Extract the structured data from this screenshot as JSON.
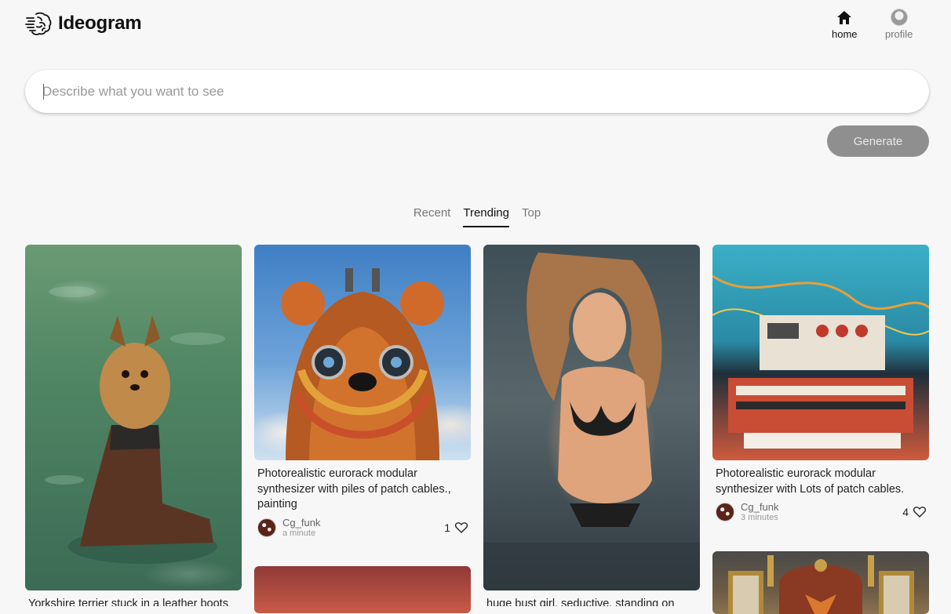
{
  "app": {
    "name": "Ideogram"
  },
  "nav": {
    "home_label": "home",
    "profile_label": "profile"
  },
  "search": {
    "placeholder": "Describe what you want to see",
    "value": ""
  },
  "generate_label": "Generate",
  "tabs": [
    {
      "label": "Recent",
      "active": false
    },
    {
      "label": "Trending",
      "active": true
    },
    {
      "label": "Top",
      "active": false
    }
  ],
  "cards": [
    {
      "image": "yorkshire-terrier-in-boot",
      "caption": "Yorkshire terrier stuck in a leather boots",
      "user": "",
      "time": "",
      "likes": ""
    },
    {
      "image": "bear-synth-painting",
      "caption": "Photorealistic eurorack modular synthesizer with piles of patch cables., painting",
      "user": "Cg_funk",
      "time": "a minute",
      "likes": "1"
    },
    {
      "image": "woman-in-swimsuit",
      "caption": "huge bust girl, seductive, standing on",
      "user": "",
      "time": "",
      "likes": ""
    },
    {
      "image": "eurorack-synth",
      "caption": "Photorealistic eurorack modular synthesizer with Lots of patch cables.",
      "user": "Cg_funk",
      "time": "3 minutes",
      "likes": "4"
    },
    {
      "image": "red-gradient",
      "caption": "",
      "user": "",
      "time": "",
      "likes": ""
    },
    {
      "image": "fox-portrait-frame",
      "caption": "",
      "user": "",
      "time": "",
      "likes": ""
    }
  ],
  "colors": {
    "accent": "#111111",
    "generate_bg": "#8f8f8f",
    "muted": "#777777"
  }
}
